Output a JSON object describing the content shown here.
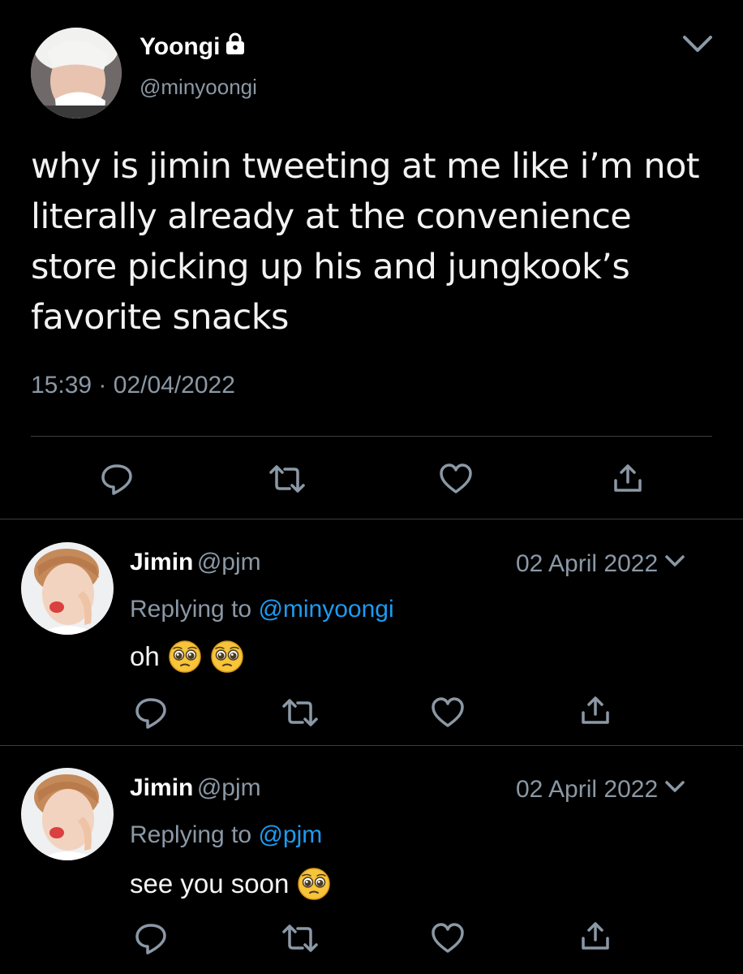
{
  "main_tweet": {
    "name": "Yoongi",
    "handle": "@minyoongi",
    "text": "why is jimin tweeting at me like i’m not literally already at the convenience store picking up his and jungkook’s favorite snacks",
    "time": "15:39",
    "separator": "·",
    "date": "02/04/2022",
    "locked": true,
    "icons": [
      "lock-icon",
      "chevron-down-icon",
      "reply-icon",
      "retweet-icon",
      "like-icon",
      "share-icon"
    ]
  },
  "replies": [
    {
      "name": "Jimin",
      "handle": "@pjm",
      "date": "02 April 2022",
      "replying_prefix": "Replying to",
      "replying_to": "@minyoongi",
      "text": "oh",
      "emojis": [
        "pleading-face-emoji",
        "pleading-face-emoji"
      ]
    },
    {
      "name": "Jimin",
      "handle": "@pjm",
      "date": "02 April 2022",
      "replying_prefix": "Replying to",
      "replying_to": "@pjm",
      "text": "see you soon",
      "emojis": [
        "pleading-face-emoji"
      ]
    }
  ],
  "colors": {
    "background": "#000000",
    "text": "#e7e9ea",
    "secondary": "#8b98a5",
    "link": "#1d9bf0",
    "divider": "#3a3d41"
  }
}
